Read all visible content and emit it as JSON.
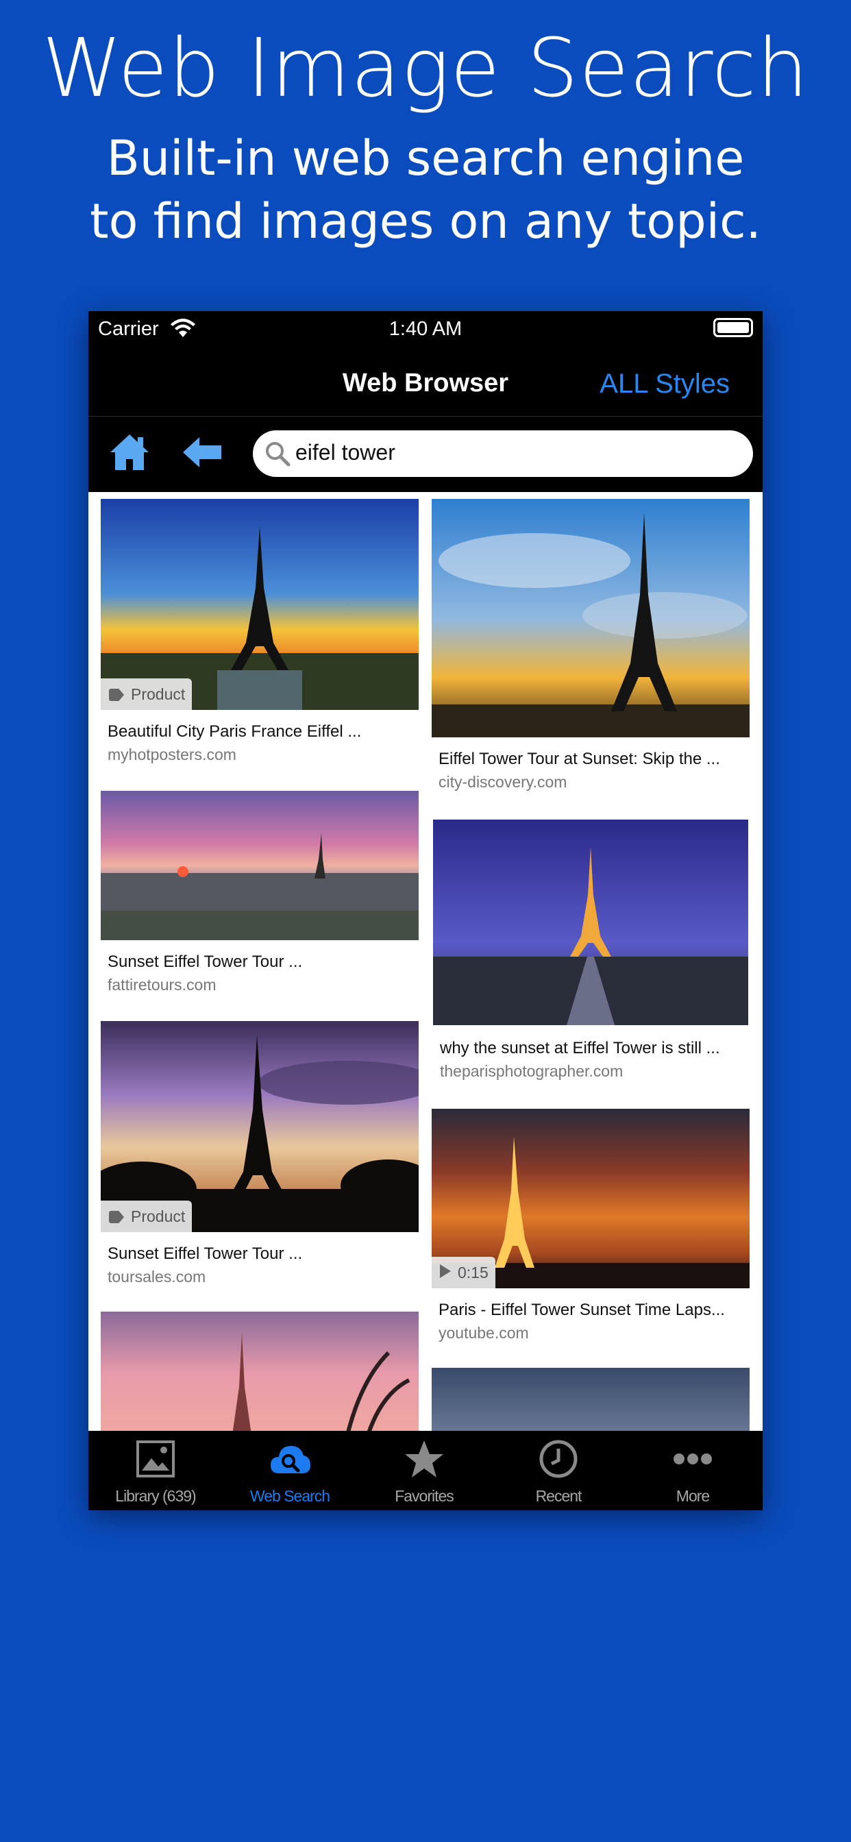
{
  "promo": {
    "headline": "Web Image Search",
    "subline_1": "Built-in web search engine",
    "subline_2": "to find images on any topic."
  },
  "status_bar": {
    "carrier": "Carrier",
    "time": "1:40 AM"
  },
  "nav": {
    "title": "Web Browser",
    "right_button": "ALL Styles"
  },
  "search": {
    "query": "eifel tower"
  },
  "results": [
    {
      "title": "Beautiful City Paris France Eiffel ...",
      "domain": "myhotposters.com",
      "badge": "Product"
    },
    {
      "title": "Eiffel Tower Tour at Sunset: Skip the ...",
      "domain": "city-discovery.com"
    },
    {
      "title": "Sunset Eiffel Tower Tour ...",
      "domain": "fattiretours.com"
    },
    {
      "title": "why the sunset at Eiffel Tower is still ...",
      "domain": "theparisphotographer.com"
    },
    {
      "title": "Sunset Eiffel Tower Tour ...",
      "domain": "toursales.com",
      "badge": "Product"
    },
    {
      "title": "Paris - Eiffel Tower Sunset Time Laps...",
      "domain": "youtube.com",
      "badge": "0:15"
    }
  ],
  "tabs": [
    {
      "label": "Library (639)",
      "icon": "photo-icon"
    },
    {
      "label": "Web Search",
      "icon": "cloud-search-icon",
      "active": true
    },
    {
      "label": "Favorites",
      "icon": "star-icon"
    },
    {
      "label": "Recent",
      "icon": "clock-icon"
    },
    {
      "label": "More",
      "icon": "more-dots-icon"
    }
  ],
  "colors": {
    "background": "#0a4cbe",
    "accent": "#1c7bf0",
    "bar": "#000000"
  }
}
